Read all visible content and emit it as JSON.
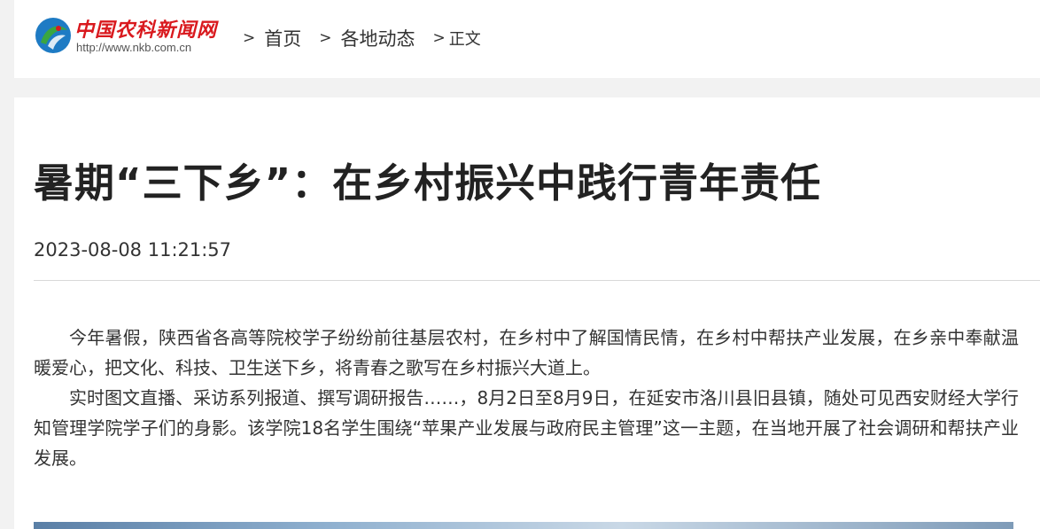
{
  "header": {
    "logo": {
      "name": "中国农科新闻网",
      "url": "http://www.nkb.com.cn"
    },
    "breadcrumb": {
      "separator": ">",
      "home": "首页",
      "section": "各地动态",
      "current": "正文"
    }
  },
  "article": {
    "title": "暑期“三下乡”：在乡村振兴中践行青年责任",
    "date": "2023-08-08 11:21:57",
    "paragraphs": [
      "今年暑假，陕西省各高等院校学子纷纷前往基层农村，在乡村中了解国情民情，在乡村中帮扶产业发展，在乡亲中奉献温暖爱心，把文化、科技、卫生送下乡，将青春之歌写在乡村振兴大道上。",
      "实时图文直播、采访系列报道、撰写调研报告……，8月2日至8月9日，在延安市洛川县旧县镇，随处可见西安财经大学行知管理学院学子们的身影。该学院18名学生围绕“苹果产业发展与政府民主管理”这一主题，在当地开展了社会调研和帮扶产业发展。"
    ]
  },
  "colors": {
    "brand_red": "#d9191e",
    "logo_green": "#3aa640",
    "logo_blue": "#1e7bc4",
    "page_bg": "#f2f2f2"
  }
}
